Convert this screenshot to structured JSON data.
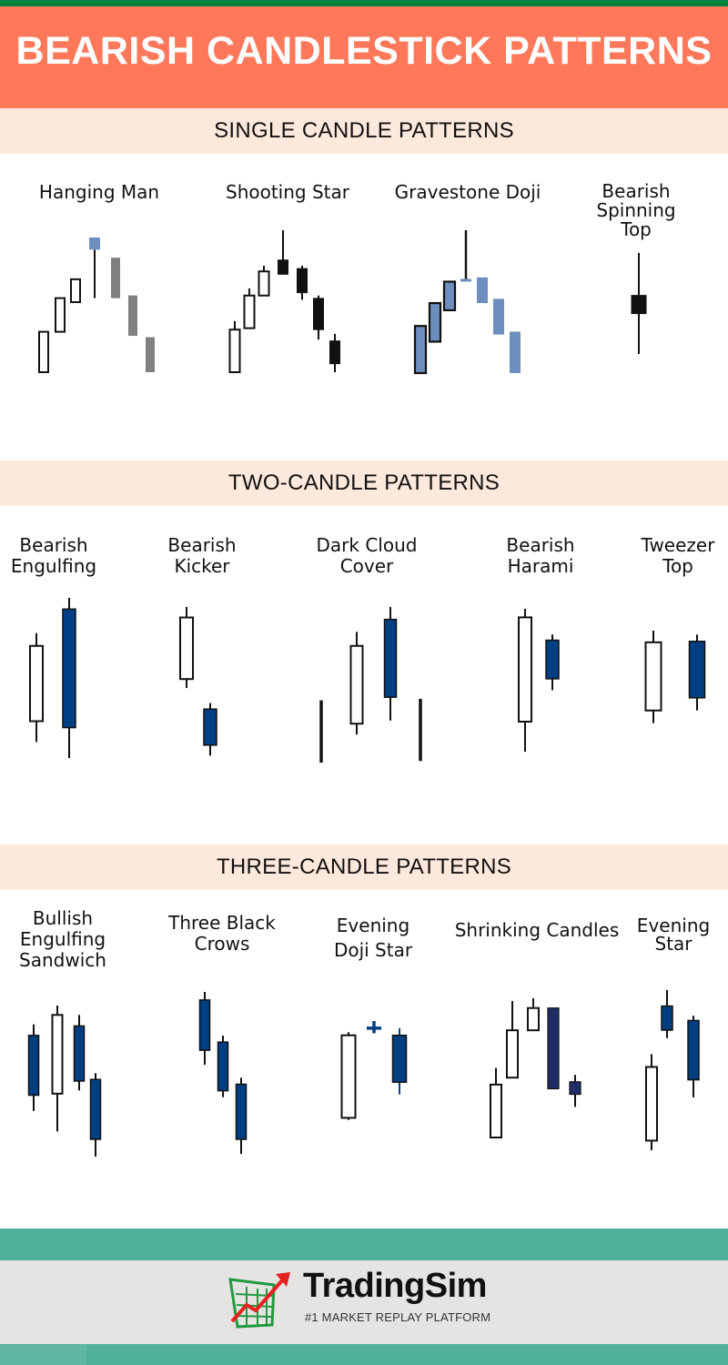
{
  "title": "BEARISH CANDLESTICK PATTERNS",
  "colors": {
    "top_stripe": "#00843d",
    "header_bg": "#ff7859",
    "section_band_bg": "#fde8dc",
    "bearish_blue": "#003f82",
    "navy": "#1f2d66",
    "steel_blue": "#6d8fbf",
    "gray": "#808080",
    "black": "#111111",
    "white": "#ffffff",
    "footer_teal": "#5dbfa9"
  },
  "sections": [
    {
      "heading": "SINGLE CANDLE PATTERNS",
      "patterns": [
        {
          "name": "Hanging Man",
          "candles": [
            {
              "type": "hollow",
              "open": 0,
              "close": 30,
              "high": 30,
              "low": 0
            },
            {
              "type": "hollow",
              "open": 30,
              "close": 55,
              "high": 55,
              "low": 30
            },
            {
              "type": "hollow",
              "open": 52,
              "close": 69,
              "high": 69,
              "low": 52
            },
            {
              "type": "steel_blue",
              "open": 100,
              "close": 91,
              "high": 100,
              "low": 55
            },
            {
              "type": "gray",
              "open": 85,
              "close": 55,
              "high": 85,
              "low": 55
            },
            {
              "type": "gray",
              "open": 57,
              "close": 27,
              "high": 57,
              "low": 27
            },
            {
              "type": "gray",
              "open": 26,
              "close": 0,
              "high": 26,
              "low": 0
            }
          ]
        },
        {
          "name": "Shooting Star",
          "candles": [
            {
              "type": "hollow",
              "open": 0,
              "close": 30,
              "high": 36,
              "low": 0
            },
            {
              "type": "hollow",
              "open": 31,
              "close": 54,
              "high": 59,
              "low": 31
            },
            {
              "type": "hollow",
              "open": 54,
              "close": 71,
              "high": 75,
              "low": 54
            },
            {
              "type": "black",
              "open": 79,
              "close": 69,
              "high": 100,
              "low": 69
            },
            {
              "type": "black",
              "open": 73,
              "close": 56,
              "high": 75,
              "low": 51
            },
            {
              "type": "black",
              "open": 52,
              "close": 30,
              "high": 54,
              "low": 23
            },
            {
              "type": "black",
              "open": 22,
              "close": 6,
              "high": 27,
              "low": 0
            }
          ]
        },
        {
          "name": "Gravestone Doji",
          "candles": [
            {
              "type": "steel_blue_outlined",
              "open": 0,
              "close": 33,
              "high": 33,
              "low": 0
            },
            {
              "type": "steel_blue_outlined",
              "open": 22,
              "close": 49,
              "high": 49,
              "low": 22
            },
            {
              "type": "steel_blue_outlined",
              "open": 44,
              "close": 64,
              "high": 64,
              "low": 44
            },
            {
              "type": "doji",
              "open": 65,
              "close": 65,
              "high": 100,
              "low": 65
            },
            {
              "type": "steel_blue",
              "open": 67,
              "close": 49,
              "high": 67,
              "low": 49
            },
            {
              "type": "steel_blue",
              "open": 52,
              "close": 27,
              "high": 52,
              "low": 27
            },
            {
              "type": "steel_blue",
              "open": 29,
              "close": 0,
              "high": 29,
              "low": 0
            }
          ]
        },
        {
          "name": "Bearish\nSpinning Top",
          "candles": [
            {
              "type": "black",
              "open": 58,
              "close": 40,
              "high": 100,
              "low": 0
            }
          ]
        }
      ]
    },
    {
      "heading": "TWO-CANDLE PATTERNS",
      "patterns": [
        {
          "name": "Bearish\nEngulfing",
          "candles": [
            {
              "type": "hollow",
              "open": 23,
              "close": 70,
              "high": 78,
              "low": 10
            },
            {
              "type": "blue",
              "open": 93,
              "close": 19,
              "high": 100,
              "low": 0
            }
          ]
        },
        {
          "name": "Bearish\nKicker",
          "candles": [
            {
              "type": "hollow",
              "open": 52,
              "close": 93,
              "high": 100,
              "low": 46
            },
            {
              "type": "blue",
              "open": 32,
              "close": 8,
              "high": 36,
              "low": 1
            }
          ]
        },
        {
          "name": "Dark Cloud\nCover",
          "candles": [
            {
              "type": "line",
              "open": 40,
              "close": 0,
              "high": 40,
              "low": 0
            },
            {
              "type": "hollow",
              "open": 25,
              "close": 75,
              "high": 84,
              "low": 18
            },
            {
              "type": "blue",
              "open": 92,
              "close": 42,
              "high": 100,
              "low": 27
            },
            {
              "type": "line",
              "open": 41,
              "close": 1,
              "high": 41,
              "low": 1
            }
          ]
        },
        {
          "name": "Bearish\nHarami",
          "candles": [
            {
              "type": "hollow",
              "open": 21,
              "close": 94,
              "high": 100,
              "low": 0
            },
            {
              "type": "blue",
              "open": 78,
              "close": 51,
              "high": 82,
              "low": 43
            }
          ]
        },
        {
          "name": "Tweezer\nTop",
          "candles": [
            {
              "type": "hollow",
              "open": 18,
              "close": 88,
              "high": 100,
              "low": 5
            },
            {
              "type": "blue",
              "open": 89,
              "close": 31,
              "high": 96,
              "low": 18
            }
          ]
        }
      ]
    },
    {
      "heading": "THREE-CANDLE PATTERNS",
      "patterns": [
        {
          "name": "Bullish\nEngulfing\nSandwich",
          "candles": [
            {
              "type": "blue",
              "open": 77,
              "close": 39,
              "high": 84,
              "low": 29
            },
            {
              "type": "hollow",
              "open": 40,
              "close": 90,
              "high": 96,
              "low": 16
            },
            {
              "type": "blue",
              "open": 83,
              "close": 48,
              "high": 90,
              "low": 42
            },
            {
              "type": "blue",
              "open": 49,
              "close": 11,
              "high": 53,
              "low": 0
            }
          ]
        },
        {
          "name": "Three Black\nCrows",
          "candles": [
            {
              "type": "blue",
              "open": 95,
              "close": 64,
              "high": 100,
              "low": 55
            },
            {
              "type": "blue",
              "open": 69,
              "close": 39,
              "high": 73,
              "low": 35
            },
            {
              "type": "blue",
              "open": 43,
              "close": 9,
              "high": 47,
              "low": 0
            }
          ]
        },
        {
          "name": "Evening\nDoji Star",
          "candles": [
            {
              "type": "hollow",
              "open": 5,
              "close": 86,
              "high": 89,
              "low": 3
            },
            {
              "type": "doji_cross",
              "open": 93,
              "close": 93,
              "high": 100,
              "low": 88
            },
            {
              "type": "blue",
              "open": 86,
              "close": 40,
              "high": 93,
              "low": 28
            }
          ]
        },
        {
          "name": "Shrinking Candles",
          "candles": [
            {
              "type": "hollow",
              "open": 0,
              "close": 38,
              "high": 50,
              "low": 0
            },
            {
              "type": "hollow",
              "open": 43,
              "close": 77,
              "high": 98,
              "low": 43
            },
            {
              "type": "hollow",
              "open": 77,
              "close": 93,
              "high": 100,
              "low": 77
            },
            {
              "type": "navy",
              "open": 93,
              "close": 35,
              "high": 93,
              "low": 35
            },
            {
              "type": "navy",
              "open": 40,
              "close": 31,
              "high": 45,
              "low": 22
            }
          ]
        },
        {
          "name": "Evening\nStar",
          "candles": [
            {
              "type": "hollow",
              "open": 6,
              "close": 52,
              "high": 60,
              "low": 0
            },
            {
              "type": "blue",
              "open": 90,
              "close": 75,
              "high": 100,
              "low": 70
            },
            {
              "type": "blue",
              "open": 81,
              "close": 44,
              "high": 84,
              "low": 33
            }
          ]
        }
      ]
    }
  ],
  "footer": {
    "brand": "TradingSim",
    "tagline": "#1 MARKET REPLAY PLATFORM",
    "logo_icon": "chart-arrow-up-icon"
  }
}
